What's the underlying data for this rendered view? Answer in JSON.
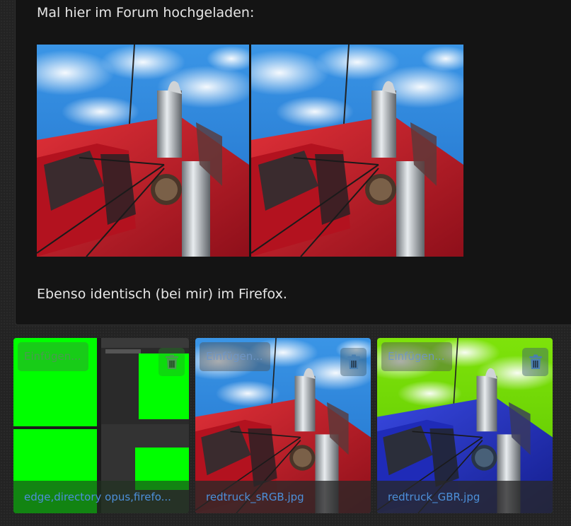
{
  "post": {
    "text_top": "Mal hier im Forum hochgeladen:",
    "text_bottom": "Ebenso identisch (bei mir) im Firefox.",
    "images": [
      {
        "alt": "redtruck_sRGB.jpg"
      },
      {
        "alt": "redtruck_GBR.jpg"
      }
    ]
  },
  "attachments": [
    {
      "insert_label": "Einfügen...",
      "caption": "edge,directory opus,firefo...",
      "icon": "trash-icon"
    },
    {
      "insert_label": "Einfügen...",
      "caption": "redtruck_sRGB.jpg",
      "icon": "trash-icon"
    },
    {
      "insert_label": "Einfügen...",
      "caption": "redtruck_GBR.jpg",
      "icon": "trash-icon"
    }
  ],
  "colors": {
    "truck_red": "#c81e2a",
    "truck_blue": "#2233cc",
    "sky_blue": "#2e8be0",
    "lime_green": "#00ff00",
    "link_blue": "#4c8fd9"
  }
}
